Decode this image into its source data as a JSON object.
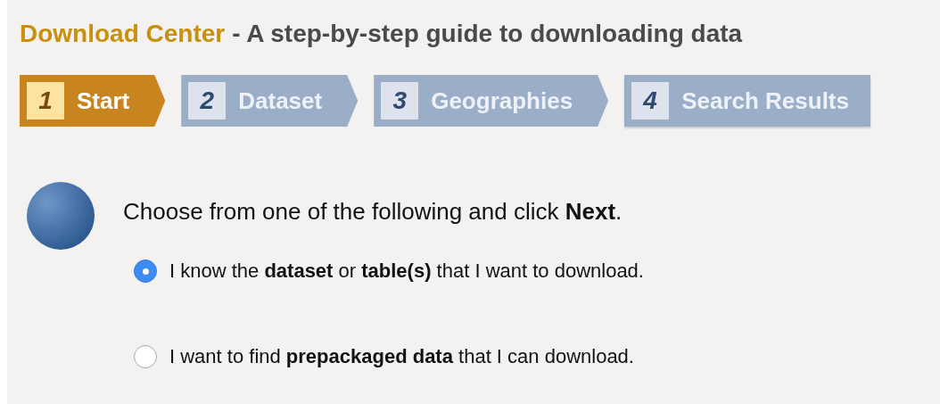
{
  "header": {
    "title": "Download Center",
    "subtitle": "- A step-by-step guide to downloading data"
  },
  "steps": [
    {
      "number": "1",
      "label": "Start",
      "selected": true
    },
    {
      "number": "2",
      "label": "Dataset",
      "selected": false
    },
    {
      "number": "3",
      "label": "Geographies",
      "selected": false
    },
    {
      "number": "4",
      "label": "Search Results",
      "selected": false
    }
  ],
  "instruction": "Choose from one of the following and click **Next**.",
  "options": [
    {
      "label": "I know the **dataset** or **table(s)** that I want to download.",
      "selected": true
    },
    {
      "label": "I want to find **prepackaged data** that I can download.",
      "selected": false
    }
  ]
}
